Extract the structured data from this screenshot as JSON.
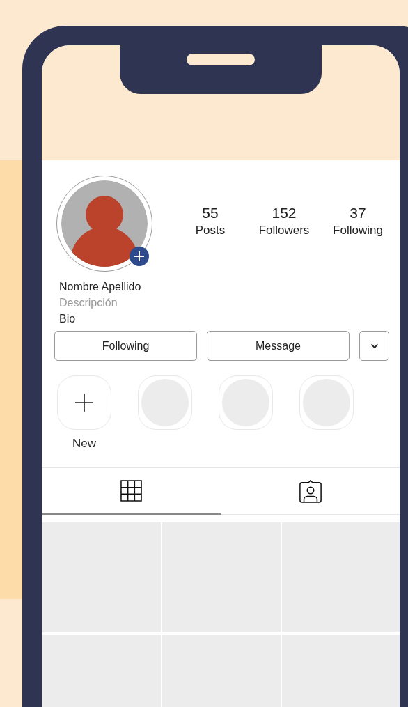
{
  "profile": {
    "name": "Nombre Apellido",
    "description": "Descripción",
    "bio": "Bio"
  },
  "stats": [
    {
      "value": "55",
      "label": "Posts"
    },
    {
      "value": "152",
      "label": "Followers"
    },
    {
      "value": "37",
      "label": "Following"
    }
  ],
  "buttons": [
    {
      "label": "Following"
    },
    {
      "label": "Message"
    }
  ],
  "highlights": [
    {
      "kind": "new",
      "label": "New"
    },
    {
      "kind": "empty"
    },
    {
      "kind": "empty"
    },
    {
      "kind": "empty"
    }
  ],
  "tabs": [
    {
      "kind": "grid",
      "selected": true
    },
    {
      "kind": "tagged",
      "selected": false
    }
  ],
  "posts": [
    {
      "kind": "placeholder"
    },
    {
      "kind": "placeholder"
    },
    {
      "kind": "placeholder"
    },
    {
      "kind": "placeholder"
    },
    {
      "kind": "placeholder"
    },
    {
      "kind": "placeholder"
    }
  ]
}
